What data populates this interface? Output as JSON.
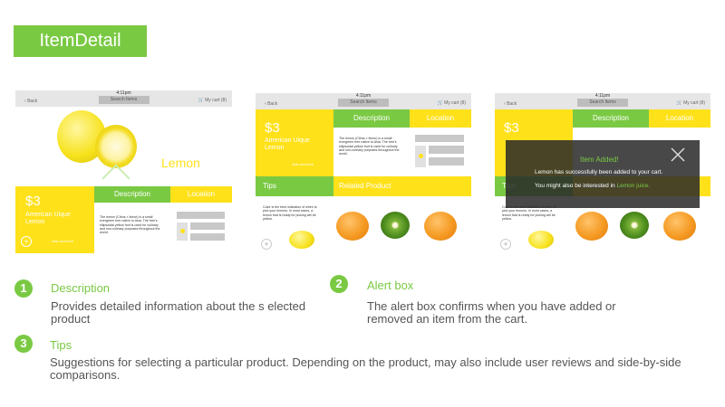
{
  "page_title": "ItemDetail",
  "statusbar": {
    "time": "4:11pm"
  },
  "topbar": {
    "back": "Back",
    "search": "Search Items",
    "cart": "My cart (8)"
  },
  "product": {
    "price": "$3",
    "name": "American Uique Lemon",
    "name_large": "Lemon",
    "description": "The lemon (Citrus × limon) is a small evergreen tree native to Asia. The tree's ellipsoidal yellow fruit is used for culinary and non-culinary purposes throughout the world.",
    "add_to_cart": "Add cart here",
    "tips_text": "Color is the best indication of when to pick your lemons. In most cases, a lemon that is ready for picking will be yellow."
  },
  "tabs": {
    "description": "Description",
    "location": "Location",
    "tips": "Tips",
    "related": "Related Product"
  },
  "alert": {
    "title": "Item Added!",
    "message": "Lemon has successfully been added to your cart.",
    "suggestion_prefix": "You might also be interested in ",
    "suggestion_link": "Lemon juice."
  },
  "captions": [
    {
      "num": "1",
      "title": "Description",
      "body": "Provides detailed information about the s elected product"
    },
    {
      "num": "2",
      "title": "Alert box",
      "body": "The alert box confirms when you have added or removed an item from the cart."
    },
    {
      "num": "3",
      "title": "Tips",
      "body": "Suggestions for selecting a particular product. Depending on the product, may also include user reviews and side-by-side comparisons."
    }
  ],
  "colors": {
    "green": "#7ac943",
    "yellow": "#ffe11a",
    "overlay": "#282828"
  }
}
